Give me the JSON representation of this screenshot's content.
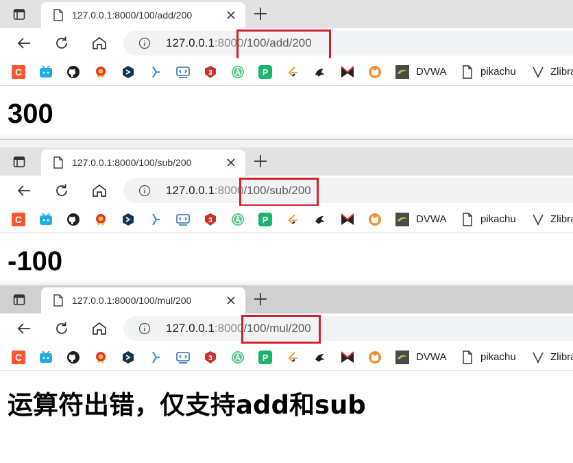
{
  "windows": [
    {
      "tab_title": "127.0.0.1:8000/100/add/200",
      "url_host": "127.0.0.1",
      "url_port": ":8000",
      "url_path": "/100/add/200",
      "result": "300"
    },
    {
      "tab_title": "127.0.0.1:8000/100/sub/200",
      "url_host": "127.0.0.1",
      "url_port": ":8000",
      "url_path": "/100/sub/200",
      "result": "-100"
    },
    {
      "tab_title": "127.0.0.1:8000/100/mul/200",
      "url_host": "127.0.0.1",
      "url_port": ":8000",
      "url_path": "/100/mul/200",
      "result": "运算符出错，仅支持add和sub"
    }
  ],
  "bookmarks": {
    "icons": [
      "csdn-icon",
      "bilibili-icon",
      "github-icon",
      "badge-icon",
      "hexagon-icon",
      "kite-icon",
      "code-box-icon",
      "shield-3-icon",
      "a-circle-icon",
      "p-green-icon",
      "leetcode-icon",
      "bird-icon",
      "m-logo-icon",
      "cat-icon"
    ],
    "dvwa_label": "DVWA",
    "pikachu_label": "pikachu",
    "zlibrary_label": "Zlibra"
  },
  "colors": {
    "highlight_box": "#d32029",
    "csdn": "#fc5531",
    "bilibili": "#23ade5"
  }
}
